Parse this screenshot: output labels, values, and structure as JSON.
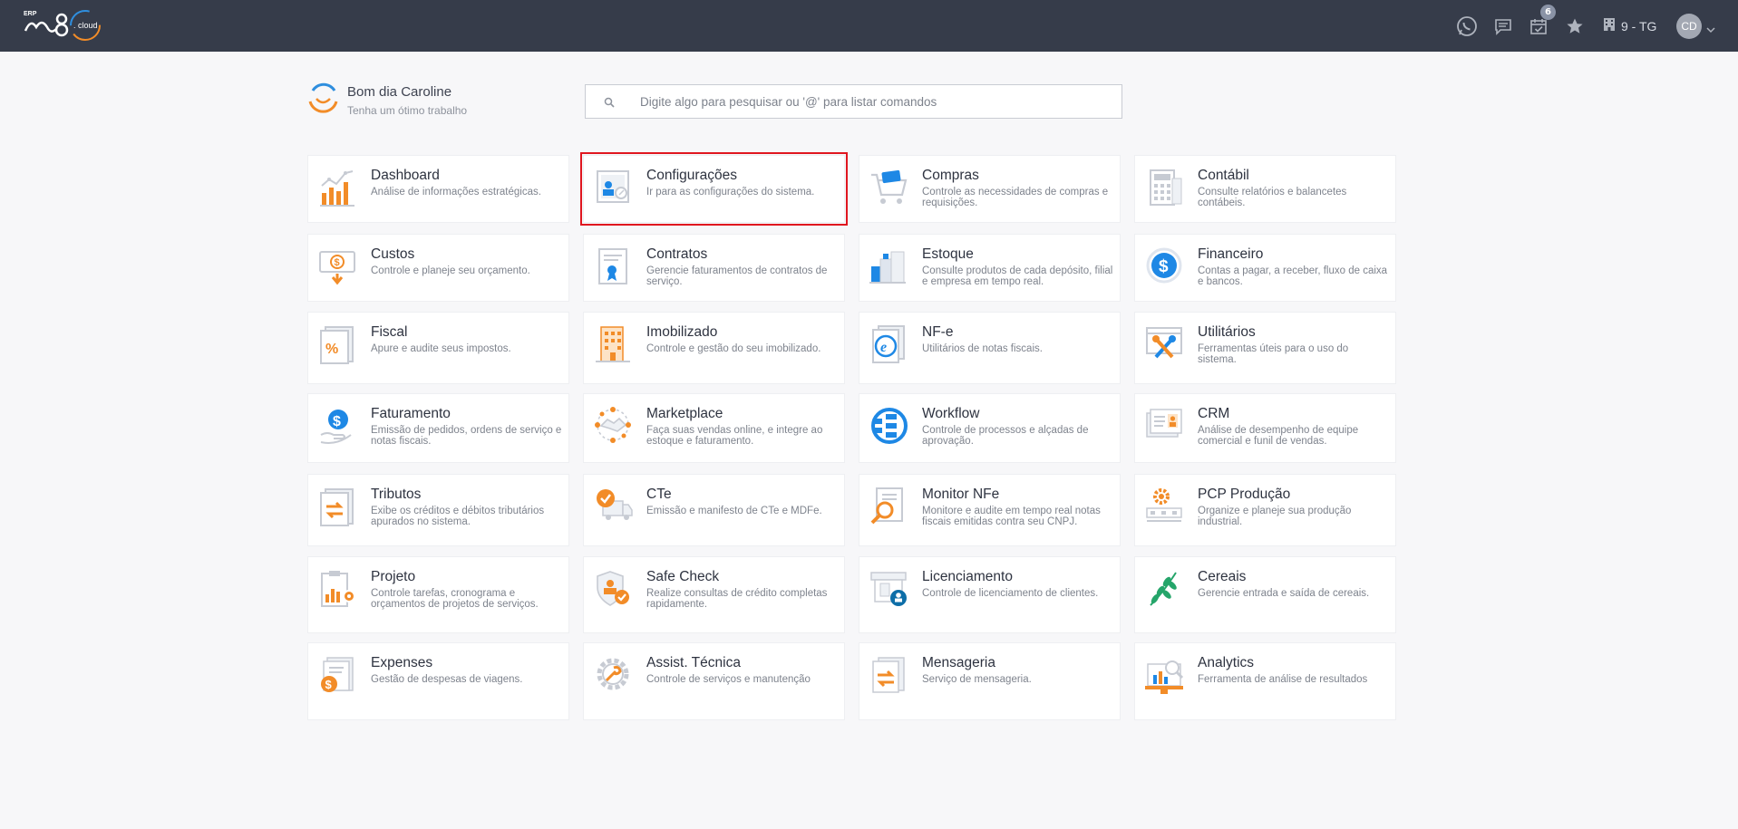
{
  "header": {
    "logo_text": "ERP m8 cloud",
    "notification_count": "6",
    "company": "9 - TG",
    "user_initials": "CD",
    "icons": [
      "whatsapp-icon",
      "chat-icon",
      "calendar-icon",
      "star-icon",
      "building-icon",
      "chevron-down-icon"
    ]
  },
  "greeting": {
    "title": "Bom dia Caroline",
    "subtitle": "Tenha um ótimo trabalho"
  },
  "search": {
    "placeholder": "Digite algo para pesquisar ou '@' para listar comandos"
  },
  "colors": {
    "orange": "#f28c28",
    "blue": "#1e88e5",
    "gray": "#c7cbd3",
    "selected_outline": "#e0161f",
    "topbar": "#363c4a"
  },
  "modules": [
    {
      "title": "Dashboard",
      "desc": "Análise de informações estratégicas.",
      "icon": "chart-icon"
    },
    {
      "title": "Configurações",
      "desc": "Ir para as configurações do sistema.",
      "icon": "settings-icon",
      "selected": true
    },
    {
      "title": "Compras",
      "desc": "Controle as necessidades de compras e requisições.",
      "icon": "cart-icon"
    },
    {
      "title": "Contábil",
      "desc": "Consulte relatórios e balancetes contábeis.",
      "icon": "calculator-icon"
    },
    {
      "title": "Custos",
      "desc": "Controle e planeje seu orçamento.",
      "icon": "money-icon"
    },
    {
      "title": "Contratos",
      "desc": "Gerencie faturamentos de contratos de serviço.",
      "icon": "contract-icon"
    },
    {
      "title": "Estoque",
      "desc": "Consulte produtos de cada depósito, filial e empresa em tempo real.",
      "icon": "warehouse-icon"
    },
    {
      "title": "Financeiro",
      "desc": "Contas a pagar, a receber, fluxo de caixa e bancos.",
      "icon": "dollar-icon"
    },
    {
      "title": "Fiscal",
      "desc": "Apure e audite seus impostos.",
      "icon": "percent-icon"
    },
    {
      "title": "Imobilizado",
      "desc": "Controle e gestão do seu imobilizado.",
      "icon": "building-icon"
    },
    {
      "title": "NF-e",
      "desc": "Utilitários de notas fiscais.",
      "icon": "nfe-icon"
    },
    {
      "title": "Utilitários",
      "desc": "Ferramentas úteis para o uso do sistema.",
      "icon": "tools-icon"
    },
    {
      "title": "Faturamento",
      "desc": "Emissão de pedidos, ordens de serviço e notas fiscais.",
      "icon": "invoice-icon"
    },
    {
      "title": "Marketplace",
      "desc": "Faça suas vendas online, e integre ao estoque e faturamento.",
      "icon": "handshake-icon"
    },
    {
      "title": "Workflow",
      "desc": "Controle de processos e alçadas de aprovação.",
      "icon": "workflow-icon"
    },
    {
      "title": "CRM",
      "desc": "Análise de desempenho de equipe comercial e funil de vendas.",
      "icon": "crm-icon"
    },
    {
      "title": "Tributos",
      "desc": "Exibe os créditos e débitos tributários apurados no sistema.",
      "icon": "tax-icon"
    },
    {
      "title": "CTe",
      "desc": "Emissão e manifesto de CTe e MDFe.",
      "icon": "truck-icon"
    },
    {
      "title": "Monitor NFe",
      "desc": "Monitore e audite em tempo real notas fiscais emitidas contra seu CNPJ.",
      "icon": "magnifier-icon"
    },
    {
      "title": "PCP Produção",
      "desc": "Organize e planeje sua produção industrial.",
      "icon": "factory-icon"
    },
    {
      "title": "Projeto",
      "desc": "Controle tarefas, cronograma e orçamentos de projetos de serviços.",
      "icon": "clipboard-icon"
    },
    {
      "title": "Safe Check",
      "desc": "Realize consultas de crédito completas rapidamente.",
      "icon": "shield-icon"
    },
    {
      "title": "Licenciamento",
      "desc": "Controle de licenciamento de clientes.",
      "icon": "license-icon"
    },
    {
      "title": "Cereais",
      "desc": "Gerencie entrada e saída de cereais.",
      "icon": "leaf-icon"
    },
    {
      "title": "Expenses",
      "desc": "Gestão de despesas de viagens.",
      "icon": "expense-icon"
    },
    {
      "title": "Assist. Técnica",
      "desc": "Controle de serviços e manutenção",
      "icon": "gear-icon"
    },
    {
      "title": "Mensageria",
      "desc": "Serviço de mensageria.",
      "icon": "message-icon"
    },
    {
      "title": "Analytics",
      "desc": "Ferramenta de análise de resultados",
      "icon": "analytics-icon"
    }
  ]
}
